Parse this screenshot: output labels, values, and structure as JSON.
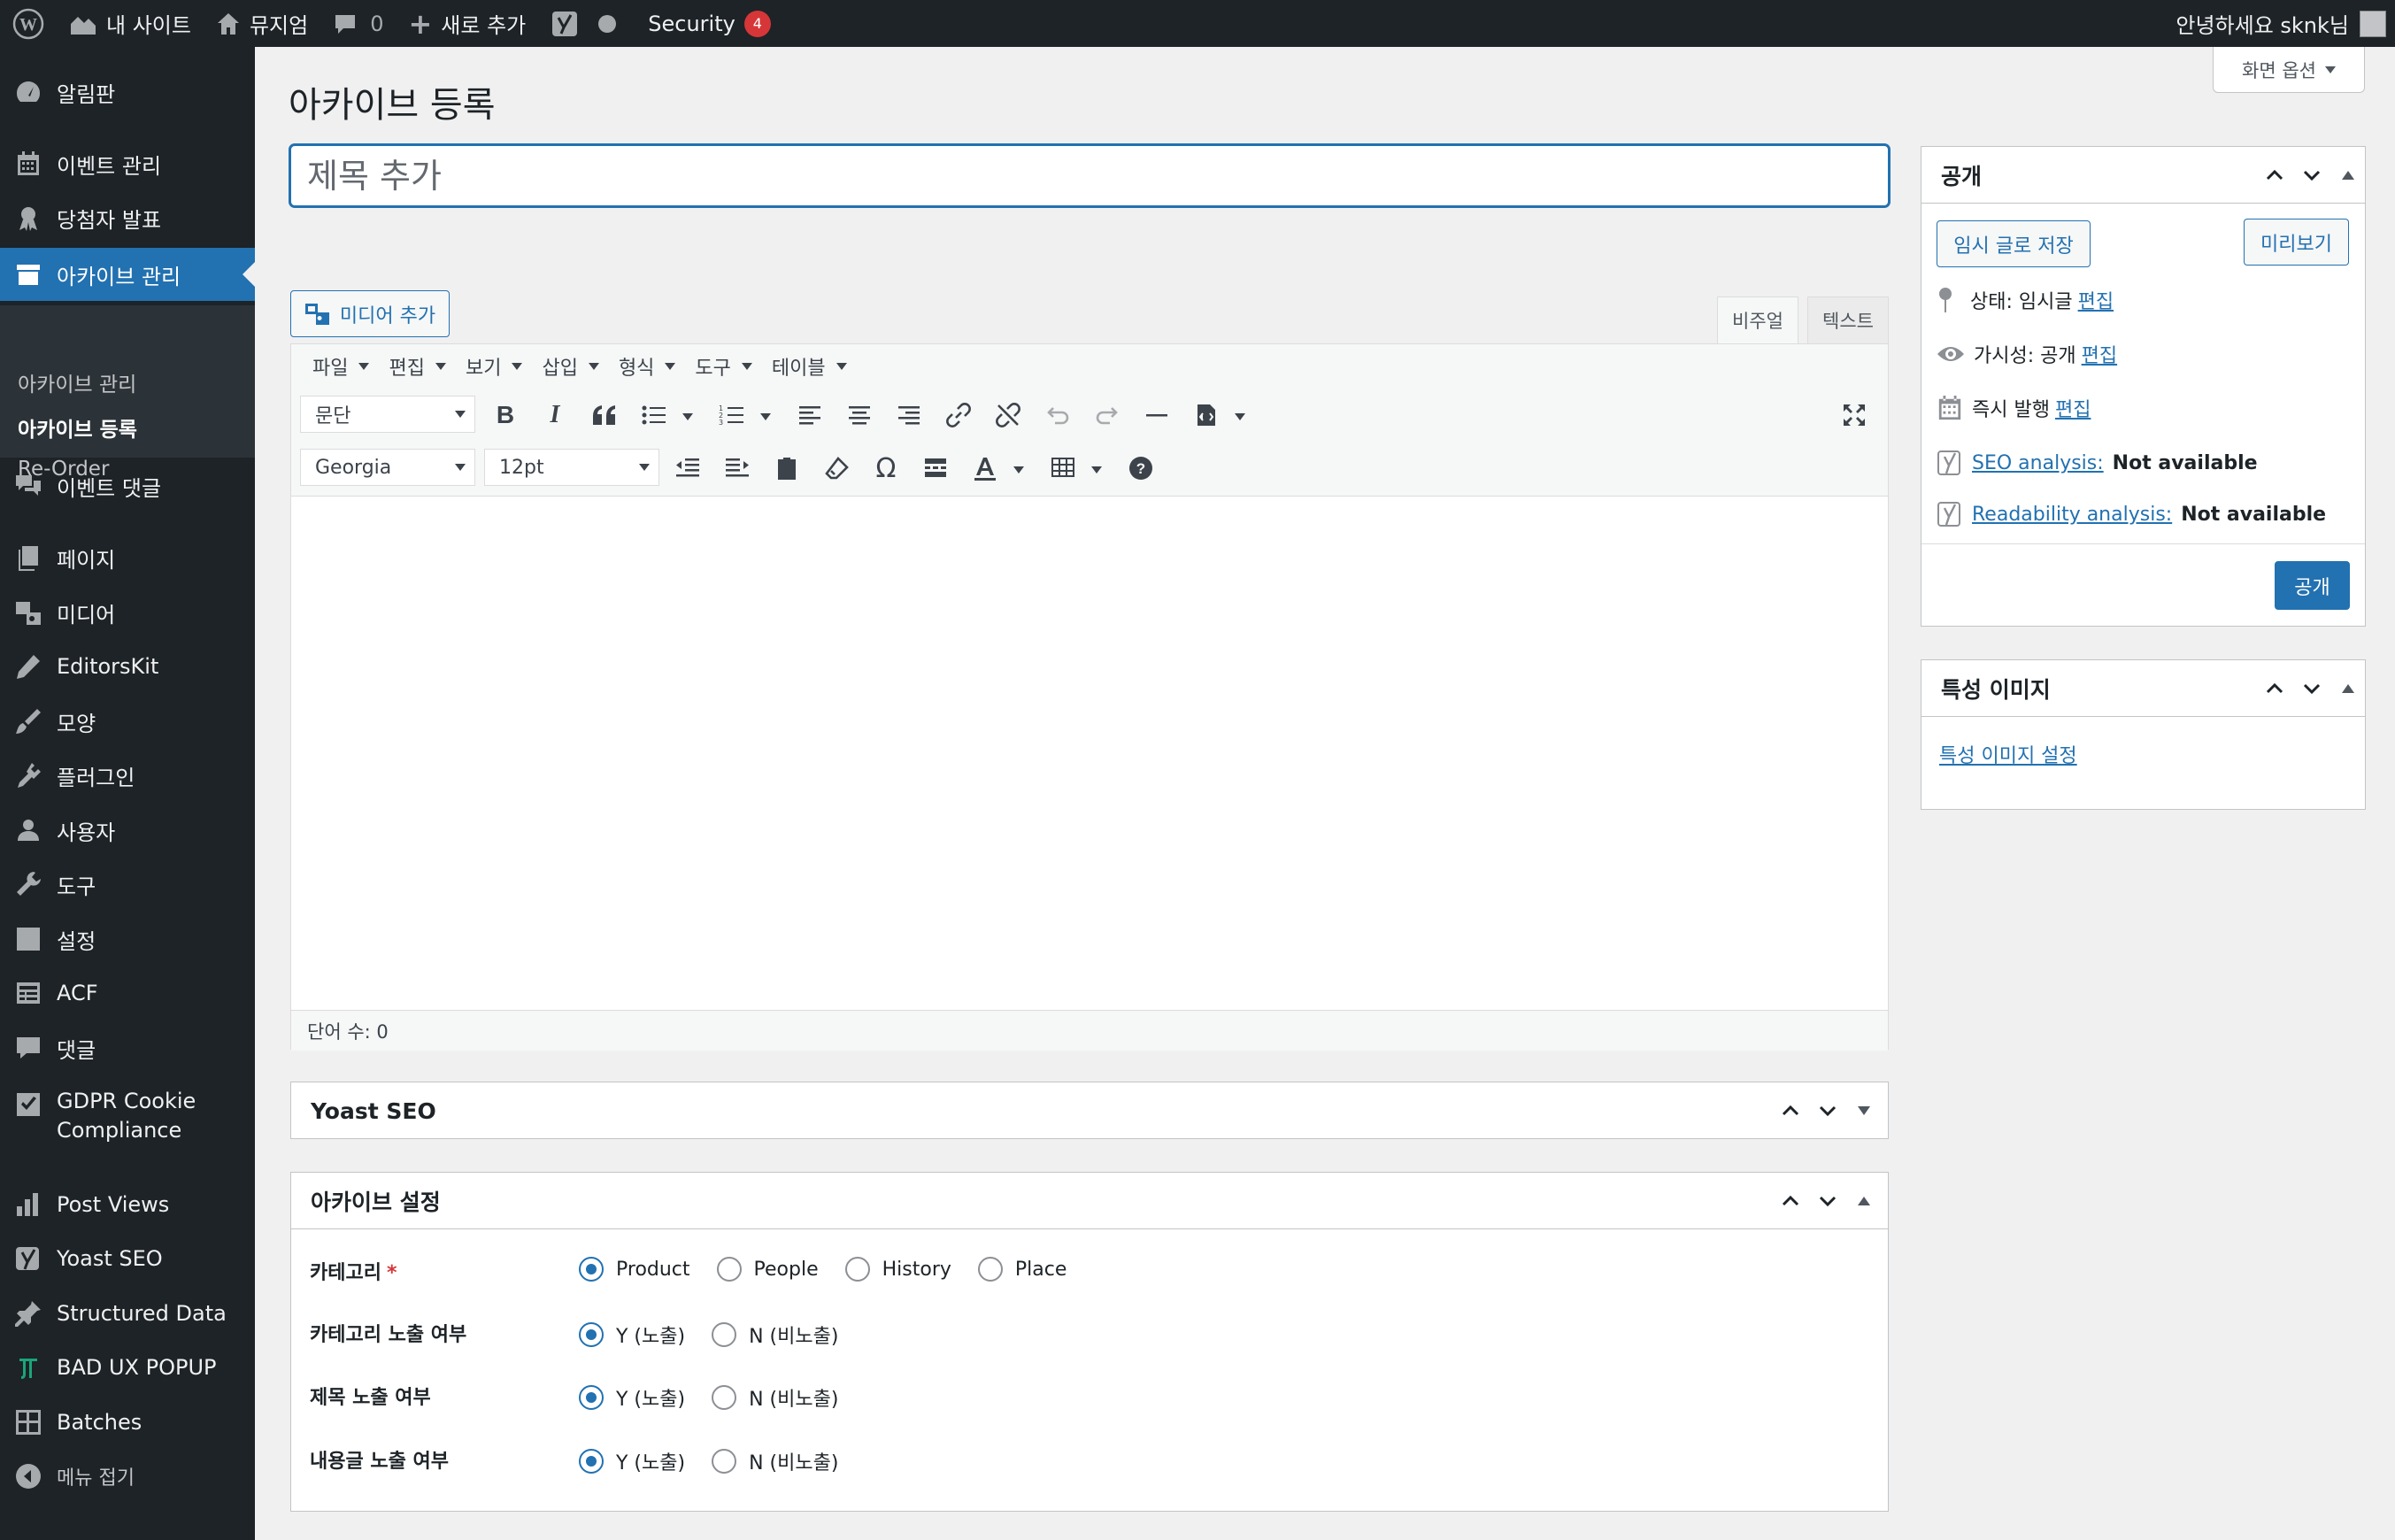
{
  "adminbar": {
    "site_name": "내 사이트",
    "museum": "뮤지엄",
    "comments_count": "0",
    "new_label": "새로 추가",
    "security_label": "Security",
    "security_count": "4",
    "greeting": "안녕하세요 sknk님"
  },
  "sidebar": {
    "items": [
      {
        "label": "알림판",
        "icon": "dashboard-icon"
      },
      {
        "label": "이벤트 관리",
        "icon": "calendar-icon"
      },
      {
        "label": "당첨자 발표",
        "icon": "award-icon"
      },
      {
        "label": "아카이브 관리",
        "icon": "archive-icon"
      },
      {
        "label": "이벤트 댓글",
        "icon": "comments-icon"
      },
      {
        "label": "페이지",
        "icon": "page-icon"
      },
      {
        "label": "미디어",
        "icon": "media-icon"
      },
      {
        "label": "EditorsKit",
        "icon": "pen-icon"
      },
      {
        "label": "모양",
        "icon": "brush-icon"
      },
      {
        "label": "플러그인",
        "icon": "plugin-icon"
      },
      {
        "label": "사용자",
        "icon": "user-icon"
      },
      {
        "label": "도구",
        "icon": "wrench-icon"
      },
      {
        "label": "설정",
        "icon": "settings-icon"
      },
      {
        "label": "ACF",
        "icon": "grid-icon"
      },
      {
        "label": "댓글",
        "icon": "comment-icon"
      },
      {
        "label": "GDPR Cookie",
        "label2": "Compliance",
        "icon": "check-icon"
      },
      {
        "label": "Post Views",
        "icon": "chart-icon"
      },
      {
        "label": "Yoast SEO",
        "icon": "yoast-icon"
      },
      {
        "label": "Structured Data",
        "icon": "pin-icon"
      },
      {
        "label": "BAD UX POPUP",
        "icon": "popup-icon"
      },
      {
        "label": "Batches",
        "icon": "batches-icon"
      },
      {
        "label": "메뉴 접기",
        "icon": "collapse-icon"
      }
    ],
    "submenu": [
      "아카이브 관리",
      "아카이브 등록",
      "Re-Order"
    ]
  },
  "main": {
    "screen_options": "화면 옵션",
    "page_title": "아카이브 등록",
    "title_placeholder": "제목 추가",
    "media_button": "미디어 추가",
    "tab_visual": "비주얼",
    "tab_text": "텍스트",
    "menubar": [
      "파일",
      "편집",
      "보기",
      "삽입",
      "형식",
      "도구",
      "테이블"
    ],
    "format_select": "문단",
    "font_select": "Georgia",
    "size_select": "12pt",
    "word_count": "단어 수: 0"
  },
  "publish": {
    "title": "공개",
    "save_draft": "임시 글로 저장",
    "preview": "미리보기",
    "status_label": "상태: 임시글",
    "visibility_label": "가시성: 공개",
    "publish_immediately": "즉시 발행",
    "edit": "편집",
    "seo_link": "SEO analysis:",
    "seo_value": "Not available",
    "readability_link": "Readability analysis:",
    "readability_value": "Not available",
    "publish_button": "공개"
  },
  "featured_image": {
    "title": "특성 이미지",
    "set_link": "특성 이미지 설정"
  },
  "yoast": {
    "title": "Yoast SEO"
  },
  "archive_settings": {
    "title": "아카이브 설정",
    "category_label": "카테고리",
    "required_mark": "*",
    "category_options": [
      "Product",
      "People",
      "History",
      "Place"
    ],
    "category_selected": "Product",
    "category_expose_label": "카테고리 노출 여부",
    "title_expose_label": "제목 노출 여부",
    "content_expose_label": "내용글 노출 여부",
    "yes_option": "Y (노출)",
    "no_option": "N (비노출)"
  },
  "colors": {
    "accent": "#2271b1",
    "adminbar": "#1d2327",
    "badge": "#d63638"
  }
}
